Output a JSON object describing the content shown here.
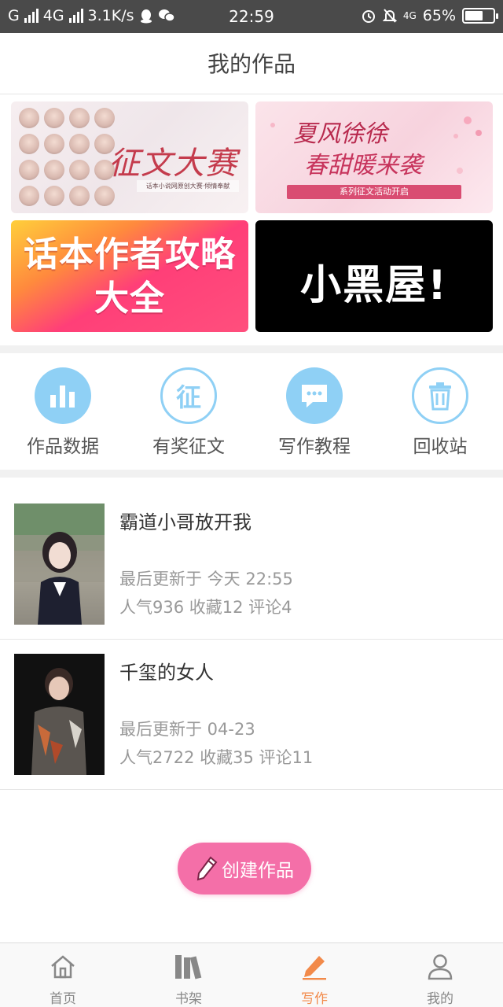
{
  "status_bar": {
    "carrier_g": "G",
    "network": "4G",
    "speed": "3.1K/s",
    "time": "22:59",
    "net_small": "4G",
    "battery_percent": "65%",
    "battery_level": 0.65,
    "icons": [
      "qq-icon",
      "wechat-icon",
      "alarm-icon",
      "bell-off-icon",
      "battery-icon"
    ]
  },
  "header": {
    "title": "我的作品"
  },
  "banners": {
    "contest": {
      "title": "征文大赛",
      "subtitle": "话本小说网原创大赛·倾情奉献"
    },
    "summer": {
      "line1": "夏风徐徐",
      "line2": "春甜暖来袭",
      "ribbon": "系列征文活动开启"
    },
    "guide": {
      "line1": "话本作者攻略",
      "line2": "大全"
    },
    "blackroom": {
      "text": "小黑屋!"
    }
  },
  "quick_actions": [
    {
      "label": "作品数据",
      "icon": "bar-chart-icon"
    },
    {
      "label": "有奖征文",
      "icon": "zheng-icon",
      "glyph": "征"
    },
    {
      "label": "写作教程",
      "icon": "chat-bubble-icon"
    },
    {
      "label": "回收站",
      "icon": "trash-icon"
    }
  ],
  "works": [
    {
      "title": "霸道小哥放开我",
      "updated": "最后更新于 今天 22:55",
      "stats": "人气936  收藏12  评论4"
    },
    {
      "title": "千玺的女人",
      "updated": "最后更新于 04-23",
      "stats": "人气2722  收藏35  评论11"
    }
  ],
  "create_button": {
    "label": "创建作品"
  },
  "bottom_nav": [
    {
      "label": "首页",
      "icon": "home-icon",
      "active": false
    },
    {
      "label": "书架",
      "icon": "bookshelf-icon",
      "active": false
    },
    {
      "label": "写作",
      "icon": "pen-icon",
      "active": true
    },
    {
      "label": "我的",
      "icon": "user-icon",
      "active": false
    }
  ],
  "colors": {
    "accent": "#f28a4a",
    "icon_blue": "#8fd0f5",
    "create_pink": "#f46fa8",
    "status_bar": "#4a4a4a"
  }
}
